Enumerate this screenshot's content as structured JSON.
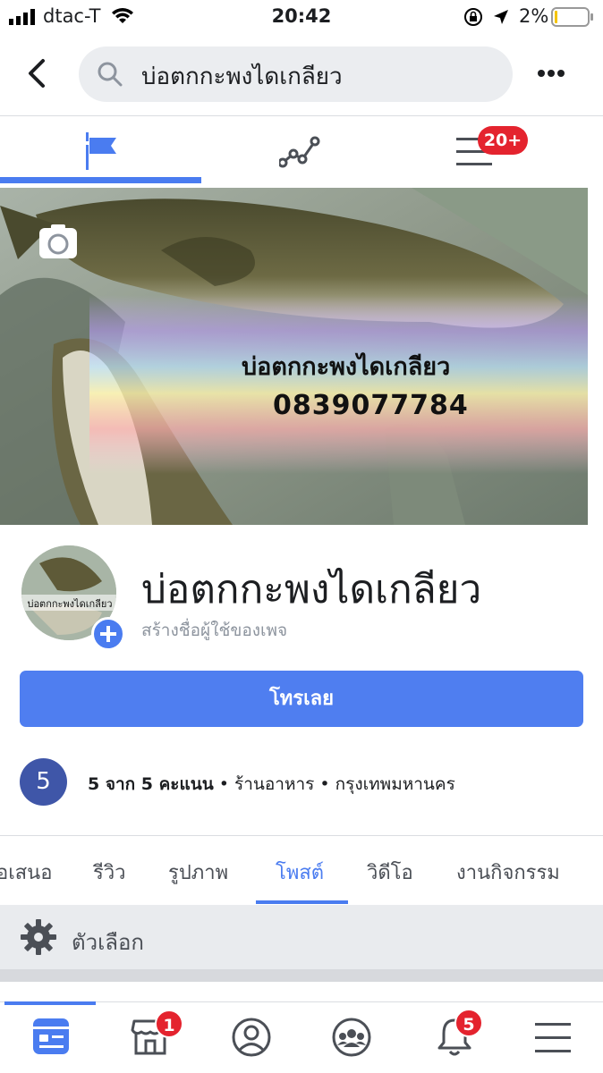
{
  "status_bar": {
    "carrier": "dtac-T",
    "time": "20:42",
    "battery_percent": "2%"
  },
  "header": {
    "search_text": "บ่อตกกะพงไดเกลียว",
    "icons": [
      "back-chevron-icon",
      "search-icon",
      "more-dots-icon"
    ]
  },
  "top_tabs": {
    "notifications_badge": "20+",
    "active": "page-flag-icon"
  },
  "cover": {
    "title": "บ่อตกกะพงไดเกลียว",
    "phone": "0839077784"
  },
  "profile": {
    "avatar_text": "บ่อตกกะพงไดเกลียว",
    "page_name": "บ่อตกกะพงไดเกลียว",
    "username_link": "สร้างชื่อผู้ใช้ของเพจ"
  },
  "cta": {
    "label": "โทรเลย"
  },
  "info": {
    "rating": "5",
    "rating_text": "5 จาก 5 คะแนน",
    "sep1": " • ",
    "category": "ร้านอาหาร",
    "sep2": " • ",
    "location": "กรุงเทพมหานคร"
  },
  "page_tabs": [
    "อเสนอ",
    "รีวิว",
    "รูปภาพ",
    "โพสต์",
    "วิดีโอ",
    "งานกิจกรรม"
  ],
  "active_page_tab": "โพสต์",
  "options": {
    "label": "ตัวเลือก"
  },
  "bottom_nav": {
    "marketplace_badge": "1",
    "notifications_badge": "5",
    "items": [
      "news-feed-icon",
      "marketplace-icon",
      "profile-icon",
      "groups-icon",
      "bell-icon",
      "menu-icon"
    ]
  },
  "colors": {
    "accent": "#4a7cf0",
    "badge": "#e4232e",
    "cta": "#4f7ef0"
  }
}
